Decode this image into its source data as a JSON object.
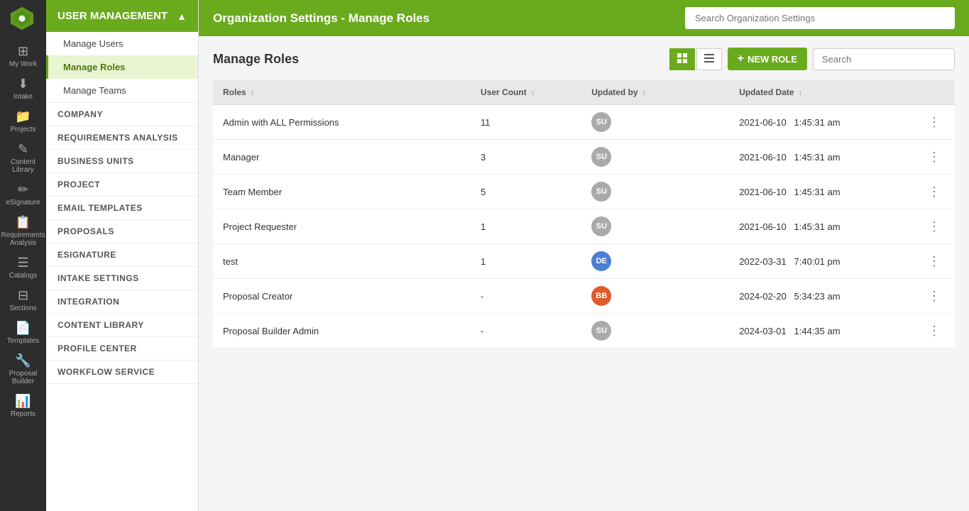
{
  "app": {
    "title": "Organization Settings - Manage Roles",
    "top_search_placeholder": "Search Organization Settings"
  },
  "icon_sidebar": {
    "items": [
      {
        "id": "my-work",
        "label": "My Work",
        "icon": "⊞"
      },
      {
        "id": "intake",
        "label": "Intake",
        "icon": "↓"
      },
      {
        "id": "projects",
        "label": "Projects",
        "icon": "📁"
      },
      {
        "id": "content-library",
        "label": "Content Library",
        "icon": "✎"
      },
      {
        "id": "esignature",
        "label": "eSignature",
        "icon": "✏"
      },
      {
        "id": "requirements-analysis",
        "label": "Requirements Analysis",
        "icon": "📋"
      },
      {
        "id": "catalogs",
        "label": "Catalogs",
        "icon": "☰"
      },
      {
        "id": "sections",
        "label": "Sections",
        "icon": "⊟"
      },
      {
        "id": "templates",
        "label": "Templates",
        "icon": "📄"
      },
      {
        "id": "proposal-builder",
        "label": "Proposal Builder",
        "icon": "🔧"
      },
      {
        "id": "reports",
        "label": "Reports",
        "icon": "📊"
      }
    ]
  },
  "nav": {
    "header": "USER MANAGEMENT",
    "items": [
      {
        "id": "manage-users",
        "label": "Manage Users",
        "active": false
      },
      {
        "id": "manage-roles",
        "label": "Manage Roles",
        "active": true
      },
      {
        "id": "manage-teams",
        "label": "Manage Teams",
        "active": false
      }
    ],
    "categories": [
      {
        "id": "company",
        "label": "COMPANY"
      },
      {
        "id": "requirements-analysis",
        "label": "REQUIREMENTS ANALYSIS"
      },
      {
        "id": "business-units",
        "label": "BUSINESS UNITS"
      },
      {
        "id": "project",
        "label": "PROJECT"
      },
      {
        "id": "email-templates",
        "label": "EMAIL TEMPLATES"
      },
      {
        "id": "proposals",
        "label": "PROPOSALS"
      },
      {
        "id": "esignature",
        "label": "ESIGNATURE"
      },
      {
        "id": "intake-settings",
        "label": "INTAKE SETTINGS"
      },
      {
        "id": "integration",
        "label": "INTEGRATION"
      },
      {
        "id": "content-library",
        "label": "CONTENT LIBRARY"
      },
      {
        "id": "profile-center",
        "label": "PROFILE CENTER"
      },
      {
        "id": "workflow-service",
        "label": "WORKFLOW SERVICE"
      }
    ]
  },
  "manage_roles": {
    "title": "Manage Roles",
    "new_role_label": "NEW ROLE",
    "search_placeholder": "Search",
    "table": {
      "headers": [
        {
          "id": "roles",
          "label": "Roles"
        },
        {
          "id": "user-count",
          "label": "User Count"
        },
        {
          "id": "updated-by",
          "label": "Updated by"
        },
        {
          "id": "updated-date",
          "label": "Updated Date"
        }
      ],
      "rows": [
        {
          "id": 1,
          "role": "Admin with ALL Permissions",
          "user_count": "11",
          "updated_by_initials": "SU",
          "updated_by_color": "gray",
          "updated_date": "2021-06-10",
          "updated_time": "1:45:31 am"
        },
        {
          "id": 2,
          "role": "Manager",
          "user_count": "3",
          "updated_by_initials": "SU",
          "updated_by_color": "gray",
          "updated_date": "2021-06-10",
          "updated_time": "1:45:31 am"
        },
        {
          "id": 3,
          "role": "Team Member",
          "user_count": "5",
          "updated_by_initials": "SU",
          "updated_by_color": "gray",
          "updated_date": "2021-06-10",
          "updated_time": "1:45:31 am"
        },
        {
          "id": 4,
          "role": "Project Requester",
          "user_count": "1",
          "updated_by_initials": "SU",
          "updated_by_color": "gray",
          "updated_date": "2021-06-10",
          "updated_time": "1:45:31 am"
        },
        {
          "id": 5,
          "role": "test",
          "user_count": "1",
          "updated_by_initials": "DE",
          "updated_by_color": "blue",
          "updated_date": "2022-03-31",
          "updated_time": "7:40:01 pm"
        },
        {
          "id": 6,
          "role": "Proposal Creator",
          "user_count": "-",
          "updated_by_initials": "BB",
          "updated_by_color": "red",
          "updated_date": "2024-02-20",
          "updated_time": "5:34:23 am"
        },
        {
          "id": 7,
          "role": "Proposal Builder Admin",
          "user_count": "-",
          "updated_by_initials": "SU",
          "updated_by_color": "gray",
          "updated_date": "2024-03-01",
          "updated_time": "1:44:35 am"
        }
      ]
    }
  },
  "colors": {
    "brand_green": "#6aab1e",
    "sidebar_dark": "#2d2d2d"
  }
}
